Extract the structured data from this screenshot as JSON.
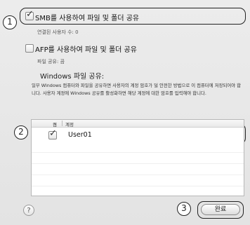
{
  "callouts": {
    "one": "1",
    "two": "2",
    "three": "3"
  },
  "smb": {
    "label": "SMB를 사용하여 파일 및 폴더 공유",
    "checked": true,
    "status": "연결된 사용자 수: 0"
  },
  "afp": {
    "label": "AFP를 사용하여 파일 및 폴더 공유",
    "checked": false,
    "status": "파일 공유: 끔"
  },
  "windows": {
    "title": "Windows 파일 공유:",
    "description": "일부 Windows 컴퓨터와 파일을 공유하면 사용자의 계정 암호가 덜 안전한 방법으로 이 컴퓨터에 저장되어야 합니다. 사용자 계정에 Windows 공유를 활성화하면 해당 계정에 대한 암호를 입력해야 합니다."
  },
  "table": {
    "col_on": "켬",
    "col_account": "계정",
    "rows": [
      {
        "checked": true,
        "account": "User01"
      }
    ]
  },
  "footer": {
    "help": "?",
    "done_label": "완료"
  }
}
